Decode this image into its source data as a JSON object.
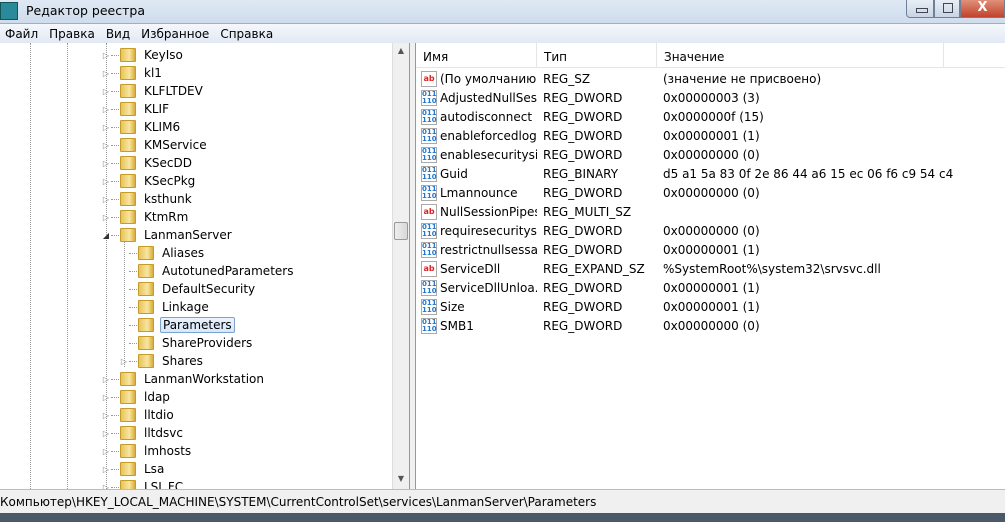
{
  "window": {
    "title": "Редактор реестра",
    "close_label": "X"
  },
  "menu": [
    "Файл",
    "Правка",
    "Вид",
    "Избранное",
    "Справка"
  ],
  "tree": [
    {
      "label": "KeyIso",
      "level": 1,
      "expander": "collapsed"
    },
    {
      "label": "kl1",
      "level": 1,
      "expander": "collapsed"
    },
    {
      "label": "KLFLTDEV",
      "level": 1,
      "expander": "collapsed"
    },
    {
      "label": "KLIF",
      "level": 1,
      "expander": "collapsed"
    },
    {
      "label": "KLIM6",
      "level": 1,
      "expander": "collapsed"
    },
    {
      "label": "KMService",
      "level": 1,
      "expander": "collapsed"
    },
    {
      "label": "KSecDD",
      "level": 1,
      "expander": "collapsed"
    },
    {
      "label": "KSecPkg",
      "level": 1,
      "expander": "collapsed"
    },
    {
      "label": "ksthunk",
      "level": 1,
      "expander": "collapsed"
    },
    {
      "label": "KtmRm",
      "level": 1,
      "expander": "collapsed"
    },
    {
      "label": "LanmanServer",
      "level": 1,
      "expander": "expanded"
    },
    {
      "label": "Aliases",
      "level": 2,
      "expander": "none"
    },
    {
      "label": "AutotunedParameters",
      "level": 2,
      "expander": "none"
    },
    {
      "label": "DefaultSecurity",
      "level": 2,
      "expander": "none"
    },
    {
      "label": "Linkage",
      "level": 2,
      "expander": "none"
    },
    {
      "label": "Parameters",
      "level": 2,
      "expander": "none",
      "selected": true
    },
    {
      "label": "ShareProviders",
      "level": 2,
      "expander": "none"
    },
    {
      "label": "Shares",
      "level": 2,
      "expander": "collapsed"
    },
    {
      "label": "LanmanWorkstation",
      "level": 1,
      "expander": "collapsed"
    },
    {
      "label": "ldap",
      "level": 1,
      "expander": "collapsed"
    },
    {
      "label": "lltdio",
      "level": 1,
      "expander": "collapsed"
    },
    {
      "label": "lltdsvc",
      "level": 1,
      "expander": "collapsed"
    },
    {
      "label": "lmhosts",
      "level": 1,
      "expander": "collapsed"
    },
    {
      "label": "Lsa",
      "level": 1,
      "expander": "collapsed"
    },
    {
      "label": "LSI_FC",
      "level": 1,
      "expander": "collapsed"
    }
  ],
  "list": {
    "columns": [
      "Имя",
      "Тип",
      "Значение"
    ],
    "rows": [
      {
        "icon": "string-value-icon",
        "name": "(По умолчанию)",
        "type": "REG_SZ",
        "value": "(значение не присвоено)"
      },
      {
        "icon": "binary-value-icon",
        "name": "AdjustedNullSes...",
        "type": "REG_DWORD",
        "value": "0x00000003 (3)"
      },
      {
        "icon": "binary-value-icon",
        "name": "autodisconnect",
        "type": "REG_DWORD",
        "value": "0x0000000f (15)"
      },
      {
        "icon": "binary-value-icon",
        "name": "enableforcedlog...",
        "type": "REG_DWORD",
        "value": "0x00000001 (1)"
      },
      {
        "icon": "binary-value-icon",
        "name": "enablesecuritysi...",
        "type": "REG_DWORD",
        "value": "0x00000000 (0)"
      },
      {
        "icon": "binary-value-icon",
        "name": "Guid",
        "type": "REG_BINARY",
        "value": "d5 a1 5a 83 0f 2e 86 44 a6 15 ec 06 f6 c9 54 c4"
      },
      {
        "icon": "binary-value-icon",
        "name": "Lmannounce",
        "type": "REG_DWORD",
        "value": "0x00000000 (0)"
      },
      {
        "icon": "string-value-icon",
        "name": "NullSessionPipes",
        "type": "REG_MULTI_SZ",
        "value": ""
      },
      {
        "icon": "binary-value-icon",
        "name": "requiresecuritysi...",
        "type": "REG_DWORD",
        "value": "0x00000000 (0)"
      },
      {
        "icon": "binary-value-icon",
        "name": "restrictnullsessa...",
        "type": "REG_DWORD",
        "value": "0x00000001 (1)"
      },
      {
        "icon": "string-value-icon",
        "name": "ServiceDll",
        "type": "REG_EXPAND_SZ",
        "value": "%SystemRoot%\\system32\\srvsvc.dll"
      },
      {
        "icon": "binary-value-icon",
        "name": "ServiceDllUnloa...",
        "type": "REG_DWORD",
        "value": "0x00000001 (1)"
      },
      {
        "icon": "binary-value-icon",
        "name": "Size",
        "type": "REG_DWORD",
        "value": "0x00000001 (1)"
      },
      {
        "icon": "binary-value-icon",
        "name": "SMB1",
        "type": "REG_DWORD",
        "value": "0x00000000 (0)"
      }
    ]
  },
  "status": {
    "path": "Компьютер\\HKEY_LOCAL_MACHINE\\SYSTEM\\CurrentControlSet\\services\\LanmanServer\\Parameters"
  }
}
